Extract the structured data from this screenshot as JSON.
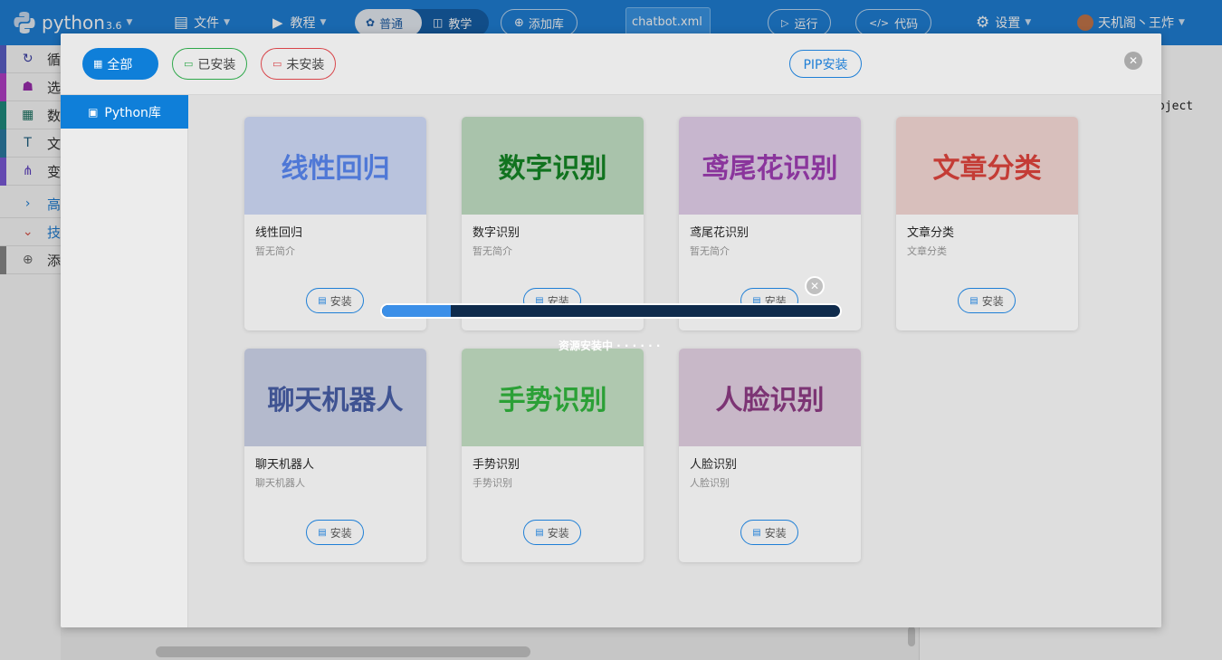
{
  "app": {
    "name": "python",
    "version": "3.6"
  },
  "topbar": {
    "file_label": "文件",
    "tutorial_label": "教程",
    "mode_normal_label": "普通",
    "mode_teach_label": "教学",
    "add_library_label": "添加库",
    "file_tab": "chatbot.xml",
    "run_label": "运行",
    "code_label": "代码",
    "settings_label": "设置",
    "user_name": "天机阁丶王炸"
  },
  "sidebar": {
    "items": [
      {
        "text": "循",
        "color": "#5b5fc7"
      },
      {
        "text": "选",
        "color": "#b33ec7"
      },
      {
        "text": "数",
        "color": "#1e8c7e"
      },
      {
        "text": "文",
        "color": "#2b7ba3"
      },
      {
        "text": "变",
        "color": "#7a5ad8"
      },
      {
        "text": "高",
        "color": "#1f7fd6"
      },
      {
        "text": "技",
        "color": "#d8554a"
      },
      {
        "text": "添",
        "color": "#888888"
      }
    ]
  },
  "workspace": {
    "code_fragment": "oject"
  },
  "modal": {
    "filter_all": "全部",
    "filter_installed": "已安装",
    "filter_uninstalled": "未安装",
    "pip_install": "PIP安装",
    "side_item": "Python库",
    "install_label": "安装",
    "cards": [
      {
        "banner": "线性回归",
        "title": "线性回归",
        "desc": "暂无简介",
        "bg": "#b9c3dd",
        "fg": "#4f78d6"
      },
      {
        "banner": "数字识别",
        "title": "数字识别",
        "desc": "暂无简介",
        "bg": "#a9c3ab",
        "fg": "#11731f"
      },
      {
        "banner": "鸢尾花识别",
        "title": "鸢尾花识别",
        "desc": "暂无简介",
        "bg": "#c7b6ce",
        "fg": "#8a359c"
      },
      {
        "banner": "文章分类",
        "title": "文章分类",
        "desc": "文章分类",
        "bg": "#d8bfbc",
        "fg": "#c43c36"
      },
      {
        "banner": "聊天机器人",
        "title": "聊天机器人",
        "desc": "聊天机器人",
        "bg": "#b4bacd",
        "fg": "#3f5392"
      },
      {
        "banner": "手势识别",
        "title": "手势识别",
        "desc": "手势识别",
        "bg": "#afc8af",
        "fg": "#2ba036"
      },
      {
        "banner": "人脸识别",
        "title": "人脸识别",
        "desc": "人脸识别",
        "bg": "#c8b8c8",
        "fg": "#7c3474"
      }
    ]
  },
  "progress": {
    "value": 0.15,
    "text": "资源安装中 · · · · · ·"
  }
}
